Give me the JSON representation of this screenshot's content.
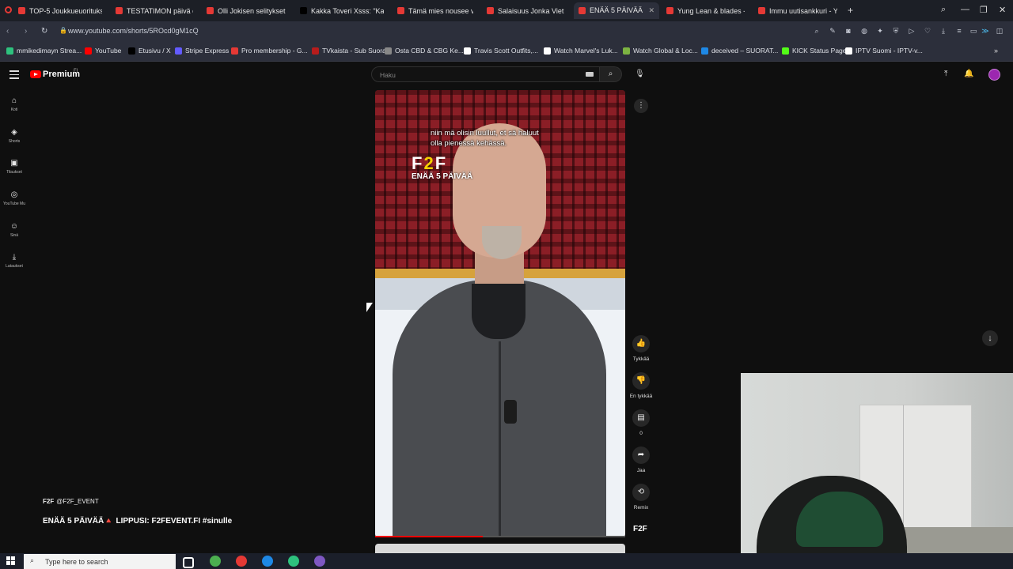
{
  "browser": {
    "tabs": [
      {
        "label": "TOP-5 Joukkueuoritukset",
        "icon_color": "#e53935",
        "active": false
      },
      {
        "label": "TESTATIMON päivä osa 1",
        "icon_color": "#e53935",
        "active": false
      },
      {
        "label": "Olli Jokisen selitykset nel",
        "icon_color": "#e53935",
        "active": false
      },
      {
        "label": "Kakka Toveri Xsss: \"Kala o",
        "icon_color": "#000000",
        "active": false
      },
      {
        "label": "Tämä mies nousee valtav",
        "icon_color": "#e53935",
        "active": false
      },
      {
        "label": "Salaisuus Jonka Viet Hau",
        "icon_color": "#e53935",
        "active": false
      },
      {
        "label": "ENÄÄ 5 PÄIVÄÄ🔺 LIP",
        "icon_color": "#e53935",
        "active": true
      },
      {
        "label": "Yung Lean & blades - INF",
        "icon_color": "#e53935",
        "active": false
      },
      {
        "label": "Immu uutisankkuri - YouT",
        "icon_color": "#e53935",
        "active": false
      }
    ],
    "tab_close": "✕",
    "new_tab": "+",
    "url": "www.youtube.com/shorts/5ROcd0gM1cQ",
    "bookmarks": [
      {
        "label": "mmikedimayn Strea...",
        "color": "#2ec27e"
      },
      {
        "label": "YouTube",
        "color": "#ff0000"
      },
      {
        "label": "Etusivu / X",
        "color": "#000000"
      },
      {
        "label": "Stripe Express",
        "color": "#635bff"
      },
      {
        "label": "Pro membership - G...",
        "color": "#e53935"
      },
      {
        "label": "TVkaista - Sub Suora",
        "color": "#b71c1c"
      },
      {
        "label": "Osta CBD & CBG Ke...",
        "color": "#888888"
      },
      {
        "label": "Travis Scott Outfits,...",
        "color": "#ffffff"
      },
      {
        "label": "Watch Marvel's Luk...",
        "color": "#ffffff"
      },
      {
        "label": "Watch Global & Loc...",
        "color": "#7cb342"
      },
      {
        "label": "deceived – SUORAT...",
        "color": "#1e88e5"
      },
      {
        "label": "KICK Status Page",
        "color": "#53fc18"
      },
      {
        "label": "IPTV Suomi - IPTV-v...",
        "color": "#ffffff"
      }
    ]
  },
  "youtube": {
    "brand": "Premium",
    "brand_superscript": "FI",
    "search_placeholder": "Haku",
    "sidebar": [
      {
        "icon": "home-icon",
        "glyph": "⌂",
        "label": "Koti"
      },
      {
        "icon": "shorts-icon",
        "glyph": "◈",
        "label": "Shorts"
      },
      {
        "icon": "subscriptions-icon",
        "glyph": "▣",
        "label": "Tilaukset"
      },
      {
        "icon": "youtube-music-icon",
        "glyph": "◎",
        "label": "YouTube Mu"
      },
      {
        "icon": "you-icon",
        "glyph": "☺",
        "label": "Sinä"
      },
      {
        "icon": "downloads-icon",
        "glyph": "⤓",
        "label": "Lataukset"
      }
    ],
    "video": {
      "caption_line1": "niin mä olisin luullut, et sä haluut",
      "caption_line2": "olla pienessä kehässä.",
      "overlay_logo_left": "F",
      "overlay_logo_mid": "2",
      "overlay_logo_right": "F",
      "overlay_text": "ENÄÄ 5 PÄIVÄÄ",
      "progress": 0.43
    },
    "actions": [
      {
        "icon": "like-icon",
        "glyph": "👍",
        "label": "Tykkää"
      },
      {
        "icon": "dislike-icon",
        "glyph": "👎",
        "label": "En tykkää"
      },
      {
        "icon": "comments-icon",
        "glyph": "▤",
        "label": "0"
      },
      {
        "icon": "share-icon",
        "glyph": "➦",
        "label": "Jaa"
      },
      {
        "icon": "remix-icon",
        "glyph": "⟲",
        "label": "Remix"
      }
    ],
    "more_glyph": "⋮",
    "channel_logo_text": "F2F",
    "channel_handle": "@F2F_EVENT",
    "description": "ENÄÄ 5 PÄIVÄÄ🔺 LIPPUSI: F2FEVENT.FI #sinulle",
    "sound_badge": "F2F"
  },
  "taskbar": {
    "search_placeholder": "Type here to search",
    "apps": [
      {
        "name": "task-view",
        "color": "#ffffff"
      },
      {
        "name": "chrome",
        "color": "#4caf50"
      },
      {
        "name": "opera",
        "color": "#e53935"
      },
      {
        "name": "edge",
        "color": "#1e88e5"
      },
      {
        "name": "app-green",
        "color": "#2ec27e"
      },
      {
        "name": "app-purple",
        "color": "#7e57c2"
      }
    ]
  },
  "colors": {
    "accent": "#ff0000",
    "background": "#0f0f0f"
  }
}
